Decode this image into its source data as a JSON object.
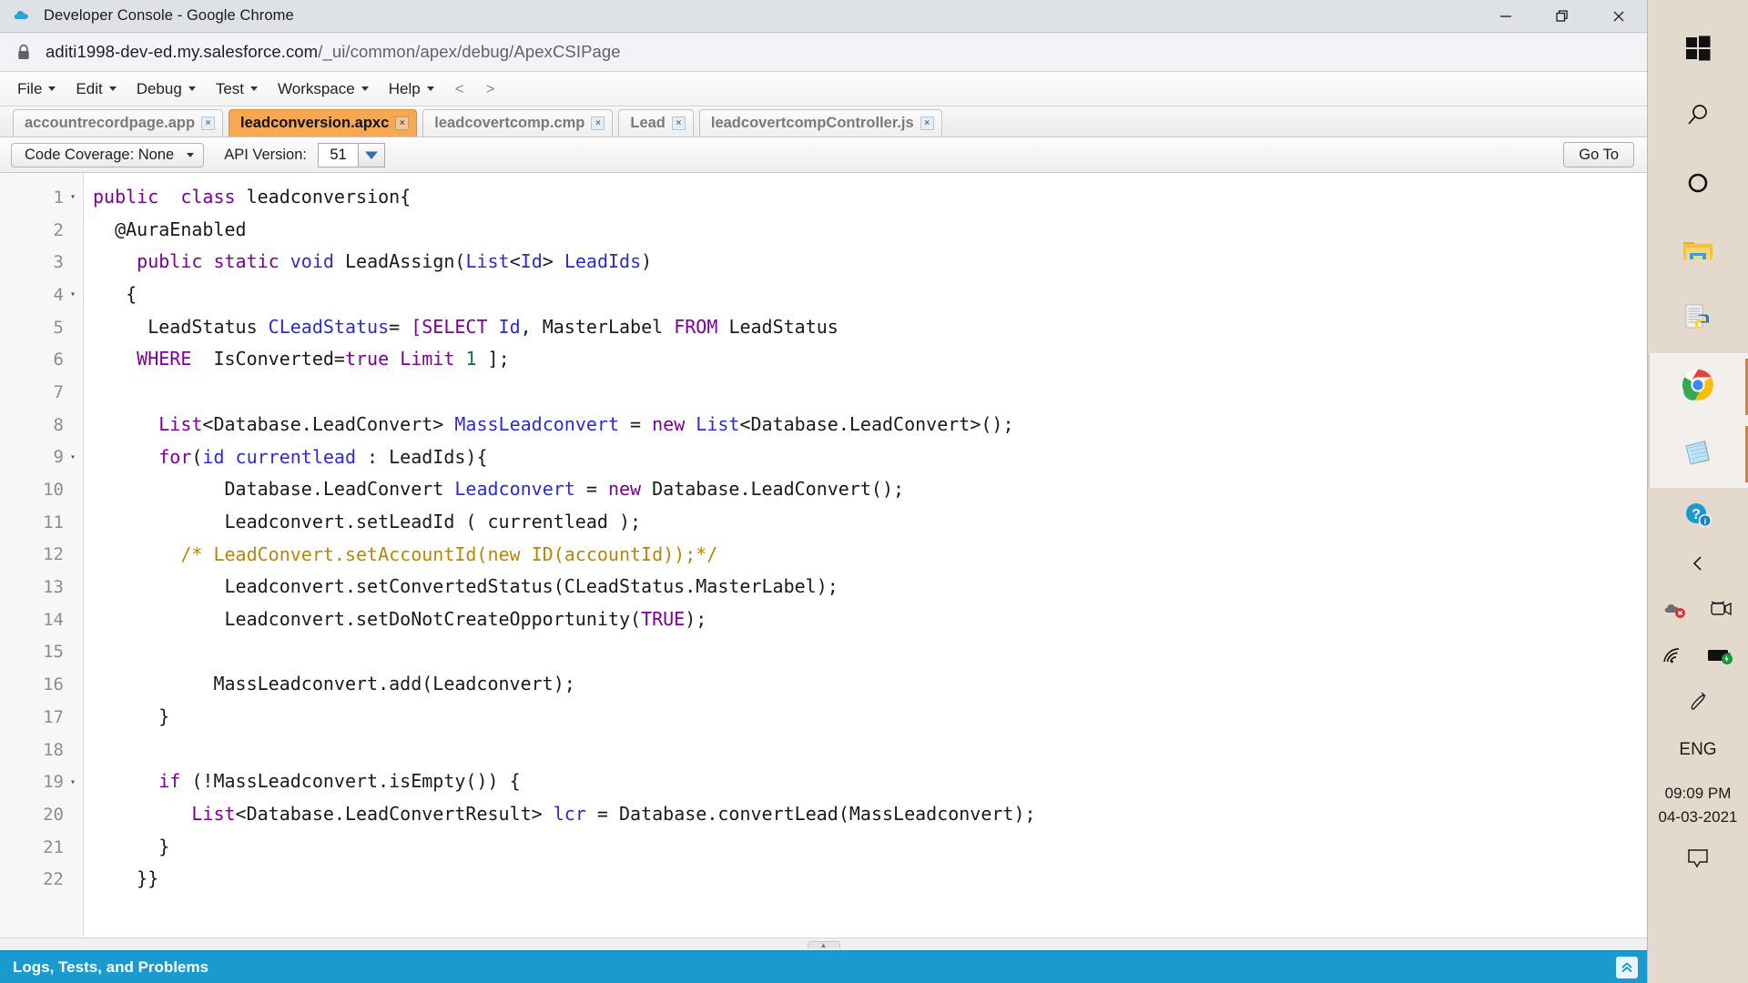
{
  "window": {
    "title": "Developer Console - Google Chrome",
    "app_icon": "chrome-cloud-icon",
    "minimize_label": "Minimize",
    "restore_label": "Restore",
    "close_label": "Close"
  },
  "address_bar": {
    "lock_icon": "lock-icon",
    "host": "aditi1998-dev-ed.my.salesforce.com",
    "path": "/_ui/common/apex/debug/ApexCSIPage"
  },
  "menubar": {
    "items": [
      {
        "label": "File",
        "has_caret": true
      },
      {
        "label": "Edit",
        "has_caret": true
      },
      {
        "label": "Debug",
        "has_caret": true
      },
      {
        "label": "Test",
        "has_caret": true
      },
      {
        "label": "Workspace",
        "has_caret": true
      },
      {
        "label": "Help",
        "has_caret": true
      }
    ],
    "nav_prev": "<",
    "nav_next": ">"
  },
  "tabs": [
    {
      "label": "accountrecordpage.app",
      "active": false,
      "close": "×"
    },
    {
      "label": "leadconversion.apxc",
      "active": true,
      "close": "×"
    },
    {
      "label": "leadcovertcomp.cmp",
      "active": false,
      "close": "×"
    },
    {
      "label": "Lead",
      "active": false,
      "close": "×"
    },
    {
      "label": "leadcovertcompController.js",
      "active": false,
      "close": "×"
    }
  ],
  "toolbar": {
    "code_coverage_label": "Code Coverage: None",
    "api_version_label": "API Version:",
    "api_version_value": "51",
    "goto_label": "Go To"
  },
  "editor": {
    "lines": [
      {
        "n": "1",
        "fold": "▾",
        "tokens": [
          {
            "t": "public  ",
            "c": "kw"
          },
          {
            "t": "class ",
            "c": "kw"
          },
          {
            "t": "leadconversion{",
            "c": "pln"
          }
        ],
        "indent": 0
      },
      {
        "n": "2",
        "fold": "",
        "tokens": [
          {
            "t": "  @AuraEnabled",
            "c": "pln"
          }
        ]
      },
      {
        "n": "3",
        "fold": "",
        "tokens": [
          {
            "t": "    ",
            "c": "pln"
          },
          {
            "t": "public ",
            "c": "kw"
          },
          {
            "t": "static ",
            "c": "kw"
          },
          {
            "t": "void ",
            "c": "kw2"
          },
          {
            "t": "LeadAssign(",
            "c": "pln"
          },
          {
            "t": "List",
            "c": "kw2"
          },
          {
            "t": "<",
            "c": "pln"
          },
          {
            "t": "Id",
            "c": "kw2"
          },
          {
            "t": "> ",
            "c": "pln"
          },
          {
            "t": "LeadIds",
            "c": "kw2"
          },
          {
            "t": ")",
            "c": "pln"
          }
        ]
      },
      {
        "n": "4",
        "fold": "▾",
        "tokens": [
          {
            "t": "   {",
            "c": "pln"
          }
        ]
      },
      {
        "n": "5",
        "fold": "",
        "tokens": [
          {
            "t": "     LeadStatus ",
            "c": "pln"
          },
          {
            "t": "CLeadStatus",
            "c": "kw2"
          },
          {
            "t": "= ",
            "c": "pln"
          },
          {
            "t": "[",
            "c": "soql"
          },
          {
            "t": "SELECT ",
            "c": "soql"
          },
          {
            "t": "Id",
            "c": "kw2"
          },
          {
            "t": ", MasterLabel ",
            "c": "pln"
          },
          {
            "t": "FROM ",
            "c": "soql"
          },
          {
            "t": "LeadStatus",
            "c": "pln"
          }
        ]
      },
      {
        "n": "6",
        "fold": "",
        "tokens": [
          {
            "t": "    ",
            "c": "pln"
          },
          {
            "t": "WHERE  ",
            "c": "soql"
          },
          {
            "t": "IsConverted=",
            "c": "pln"
          },
          {
            "t": "true ",
            "c": "kw"
          },
          {
            "t": "Limit ",
            "c": "soql"
          },
          {
            "t": "1",
            "c": "num2"
          },
          {
            "t": " ];",
            "c": "pln"
          }
        ]
      },
      {
        "n": "7",
        "fold": "",
        "tokens": [
          {
            "t": "",
            "c": "pln"
          }
        ]
      },
      {
        "n": "8",
        "fold": "",
        "tokens": [
          {
            "t": "      ",
            "c": "pln"
          },
          {
            "t": "List",
            "c": "kw"
          },
          {
            "t": "<Database.LeadConvert> ",
            "c": "pln"
          },
          {
            "t": "MassLeadconvert",
            "c": "kw2"
          },
          {
            "t": " = ",
            "c": "pln"
          },
          {
            "t": "new ",
            "c": "kw"
          },
          {
            "t": "List",
            "c": "kw2"
          },
          {
            "t": "<Database.LeadConvert>();",
            "c": "pln"
          }
        ]
      },
      {
        "n": "9",
        "fold": "▾",
        "tokens": [
          {
            "t": "      ",
            "c": "pln"
          },
          {
            "t": "for",
            "c": "kw"
          },
          {
            "t": "(",
            "c": "pln"
          },
          {
            "t": "id ",
            "c": "kw2"
          },
          {
            "t": "currentlead",
            "c": "kw2"
          },
          {
            "t": " : LeadIds){",
            "c": "pln"
          }
        ]
      },
      {
        "n": "10",
        "fold": "",
        "tokens": [
          {
            "t": "            Database.LeadConvert ",
            "c": "pln"
          },
          {
            "t": "Leadconvert",
            "c": "kw2"
          },
          {
            "t": " = ",
            "c": "pln"
          },
          {
            "t": "new ",
            "c": "kw"
          },
          {
            "t": "Database.LeadConvert();",
            "c": "pln"
          }
        ]
      },
      {
        "n": "11",
        "fold": "",
        "tokens": [
          {
            "t": "            Leadconvert.setLeadId ( currentlead );",
            "c": "pln"
          }
        ]
      },
      {
        "n": "12",
        "fold": "",
        "tokens": [
          {
            "t": "        /* LeadConvert.setAccountId(new ID(accountId));*/",
            "c": "cmt"
          }
        ]
      },
      {
        "n": "13",
        "fold": "",
        "tokens": [
          {
            "t": "            Leadconvert.setConvertedStatus(CLeadStatus.MasterLabel);",
            "c": "pln"
          }
        ]
      },
      {
        "n": "14",
        "fold": "",
        "tokens": [
          {
            "t": "            Leadconvert.setDoNotCreateOpportunity(",
            "c": "pln"
          },
          {
            "t": "TRUE",
            "c": "kw"
          },
          {
            "t": ");",
            "c": "pln"
          }
        ]
      },
      {
        "n": "15",
        "fold": "",
        "tokens": [
          {
            "t": "",
            "c": "pln"
          }
        ]
      },
      {
        "n": "16",
        "fold": "",
        "tokens": [
          {
            "t": "           MassLeadconvert.add(Leadconvert);",
            "c": "pln"
          }
        ]
      },
      {
        "n": "17",
        "fold": "",
        "tokens": [
          {
            "t": "      }",
            "c": "pln"
          }
        ]
      },
      {
        "n": "18",
        "fold": "",
        "tokens": [
          {
            "t": "",
            "c": "pln"
          }
        ]
      },
      {
        "n": "19",
        "fold": "▾",
        "tokens": [
          {
            "t": "      ",
            "c": "pln"
          },
          {
            "t": "if",
            "c": "kw"
          },
          {
            "t": " (!MassLeadconvert.isEmpty()) {",
            "c": "pln"
          }
        ]
      },
      {
        "n": "20",
        "fold": "",
        "tokens": [
          {
            "t": "         ",
            "c": "pln"
          },
          {
            "t": "List",
            "c": "kw"
          },
          {
            "t": "<Database.LeadConvertResult> ",
            "c": "pln"
          },
          {
            "t": "lcr",
            "c": "kw2"
          },
          {
            "t": " = Database.convertLead(MassLeadconvert);",
            "c": "pln"
          }
        ]
      },
      {
        "n": "21",
        "fold": "",
        "tokens": [
          {
            "t": "      }",
            "c": "pln"
          }
        ]
      },
      {
        "n": "22",
        "fold": "",
        "tokens": [
          {
            "t": "    }}",
            "c": "pln"
          }
        ]
      }
    ]
  },
  "bottom_panel": {
    "title": "Logs, Tests, and Problems",
    "expand_icon": "double-chevron-up-icon"
  },
  "taskbar": {
    "items": [
      {
        "icon": "windows-start-icon",
        "name": "start-button",
        "running": false
      },
      {
        "icon": "search-magnifier-icon",
        "name": "search-button",
        "running": false
      },
      {
        "icon": "cortana-circle-icon",
        "name": "cortana-button",
        "running": false
      },
      {
        "icon": "file-explorer-icon",
        "name": "file-explorer-button",
        "running": false
      },
      {
        "icon": "python-file-icon",
        "name": "python-app-button",
        "running": false
      },
      {
        "icon": "google-chrome-icon",
        "name": "chrome-button",
        "running": true
      },
      {
        "icon": "sticky-notes-icon",
        "name": "notepad-button",
        "running": true
      }
    ],
    "tray": {
      "help_icon": "help-question-icon",
      "show_hidden_icon": "chevron-up-icon",
      "cloud_error_icon": "onedrive-error-icon",
      "camera_icon": "camera-icon",
      "wifi_icon": "wifi-icon",
      "battery_icon": "battery-charging-icon",
      "pen_icon": "pen-icon",
      "language": "ENG",
      "time": "09:09 PM",
      "date": "04-03-2021",
      "notification_icon": "notification-speech-icon"
    }
  },
  "colors": {
    "accent_tab": "#f8a852",
    "bottom_panel": "#1b9ad0",
    "taskbar_bg": "#e4d9cd",
    "titlebar_bg": "#dee1e6"
  }
}
